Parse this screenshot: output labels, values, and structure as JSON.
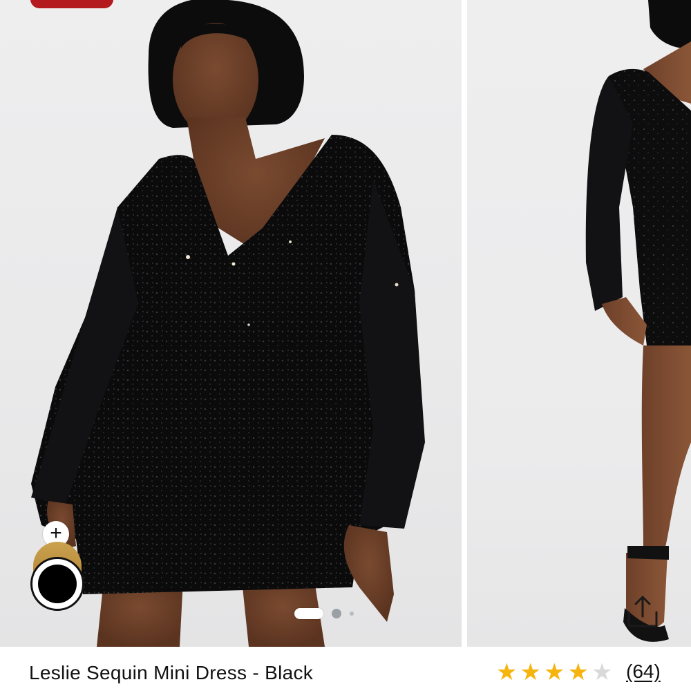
{
  "product": {
    "title": "Leslie Sequin Mini Dress - Black",
    "rating": 4,
    "rating_max": 5,
    "review_count": "(64)"
  },
  "colors": {
    "star_filled": "#f6b40e",
    "star_empty": "#d9d9d9",
    "badge": "#b3191d",
    "swatch_selected": "#000000",
    "swatch_other": "#c49a45"
  },
  "gallery": {
    "image_count": 3,
    "active_index": 1,
    "swatches": [
      {
        "name": "gold",
        "selected": false
      },
      {
        "name": "black",
        "selected": true
      }
    ],
    "add_swatch_icon": "+",
    "share_icon": "share-icon"
  }
}
